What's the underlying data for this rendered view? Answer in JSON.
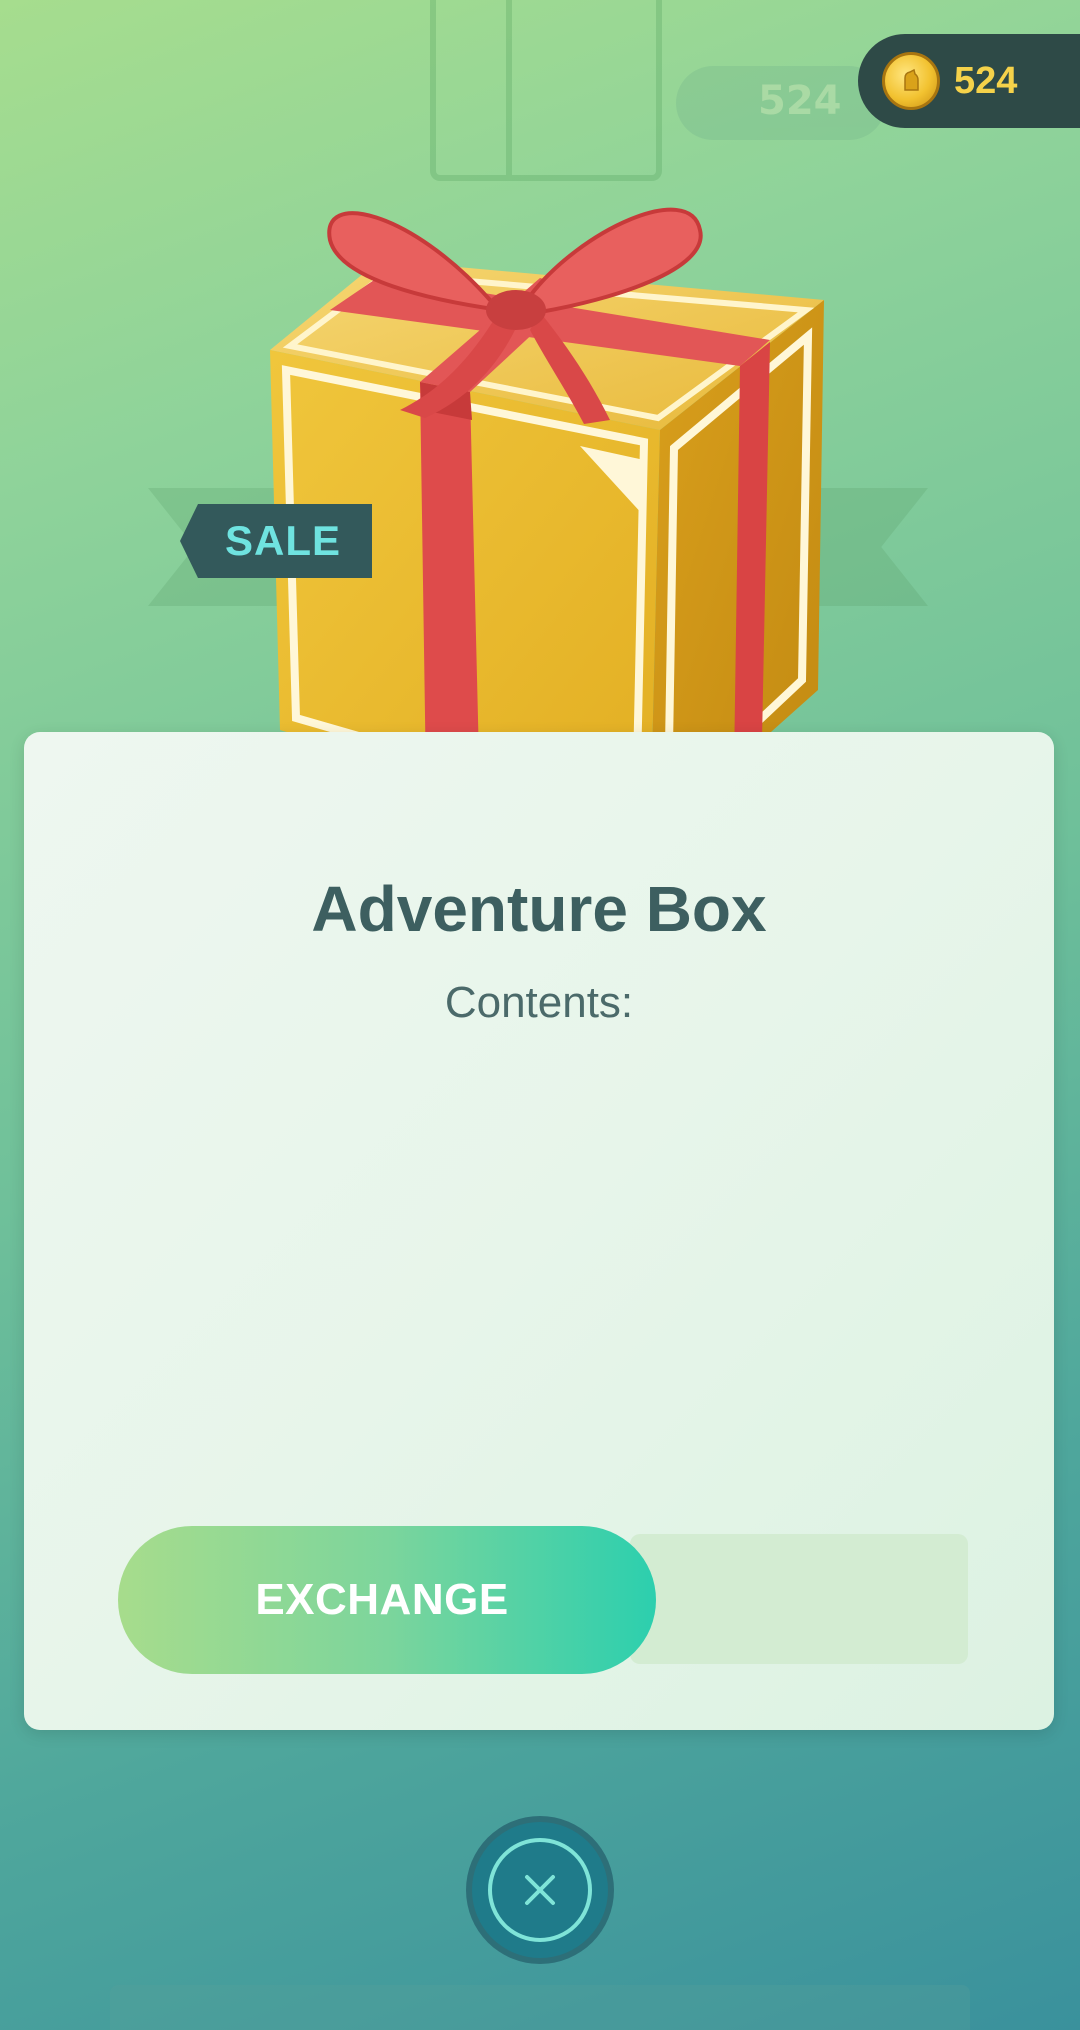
{
  "header": {
    "coin_count": "524",
    "coin_icon": "pokecoin-icon"
  },
  "background": {
    "faded_coin_count": "524"
  },
  "item": {
    "sale_label": "SALE",
    "name": "Adventure Box",
    "contents_label": "Contents:",
    "image": "gift-box-icon"
  },
  "actions": {
    "exchange_label": "EXCHANGE",
    "close_icon": "close-icon"
  },
  "colors": {
    "coin_text": "#f5d24a",
    "sale_text": "#6fe3e0",
    "title_text": "#3d5f60",
    "exchange_gradient_start": "#a7dc8c",
    "exchange_gradient_end": "#2ccfae",
    "close_button": "#1f7b8a"
  }
}
